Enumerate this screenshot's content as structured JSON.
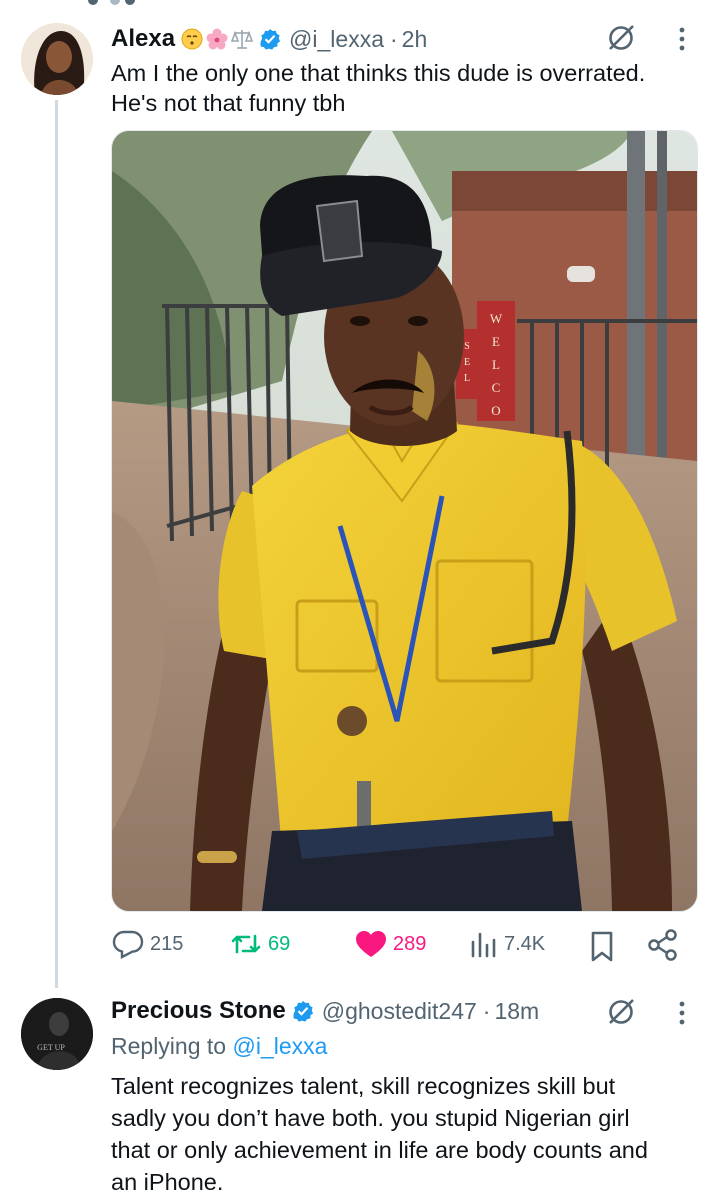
{
  "tweet": {
    "author_name": "Alexa",
    "author_emojis": [
      "kissing-face-emoji",
      "cherry-blossom-emoji",
      "balance-scale-emoji"
    ],
    "handle": "@i_lexxa",
    "time": "2h",
    "text_line1": "Am I the only one that thinks this dude is overrated.",
    "text_line2": "He's not that funny tbh",
    "photo_sign_text": [
      "W",
      "E",
      "L",
      "C",
      "O"
    ],
    "photo_sign_side": [
      "S",
      "E",
      "L"
    ],
    "stats": {
      "replies": "215",
      "reposts": "69",
      "likes": "289",
      "views": "7.4K"
    },
    "liked": true,
    "colors": {
      "repost": "#00ba7c",
      "like": "#f91880",
      "verified": "#1d9bf0",
      "muted": "#536471"
    }
  },
  "reply": {
    "author_name": "Precious Stone",
    "handle": "@ghostedit247",
    "time": "18m",
    "replying_label": "Replying to",
    "replying_handle": "@i_lexxa",
    "avatar_text": "GET UP",
    "lines": [
      "Talent recognizes talent, skill recognizes skill but",
      "sadly you don’t have both.  you stupid Nigerian girl",
      "that or only achievement in life are body counts and",
      "an iPhone."
    ]
  },
  "separator": "·"
}
